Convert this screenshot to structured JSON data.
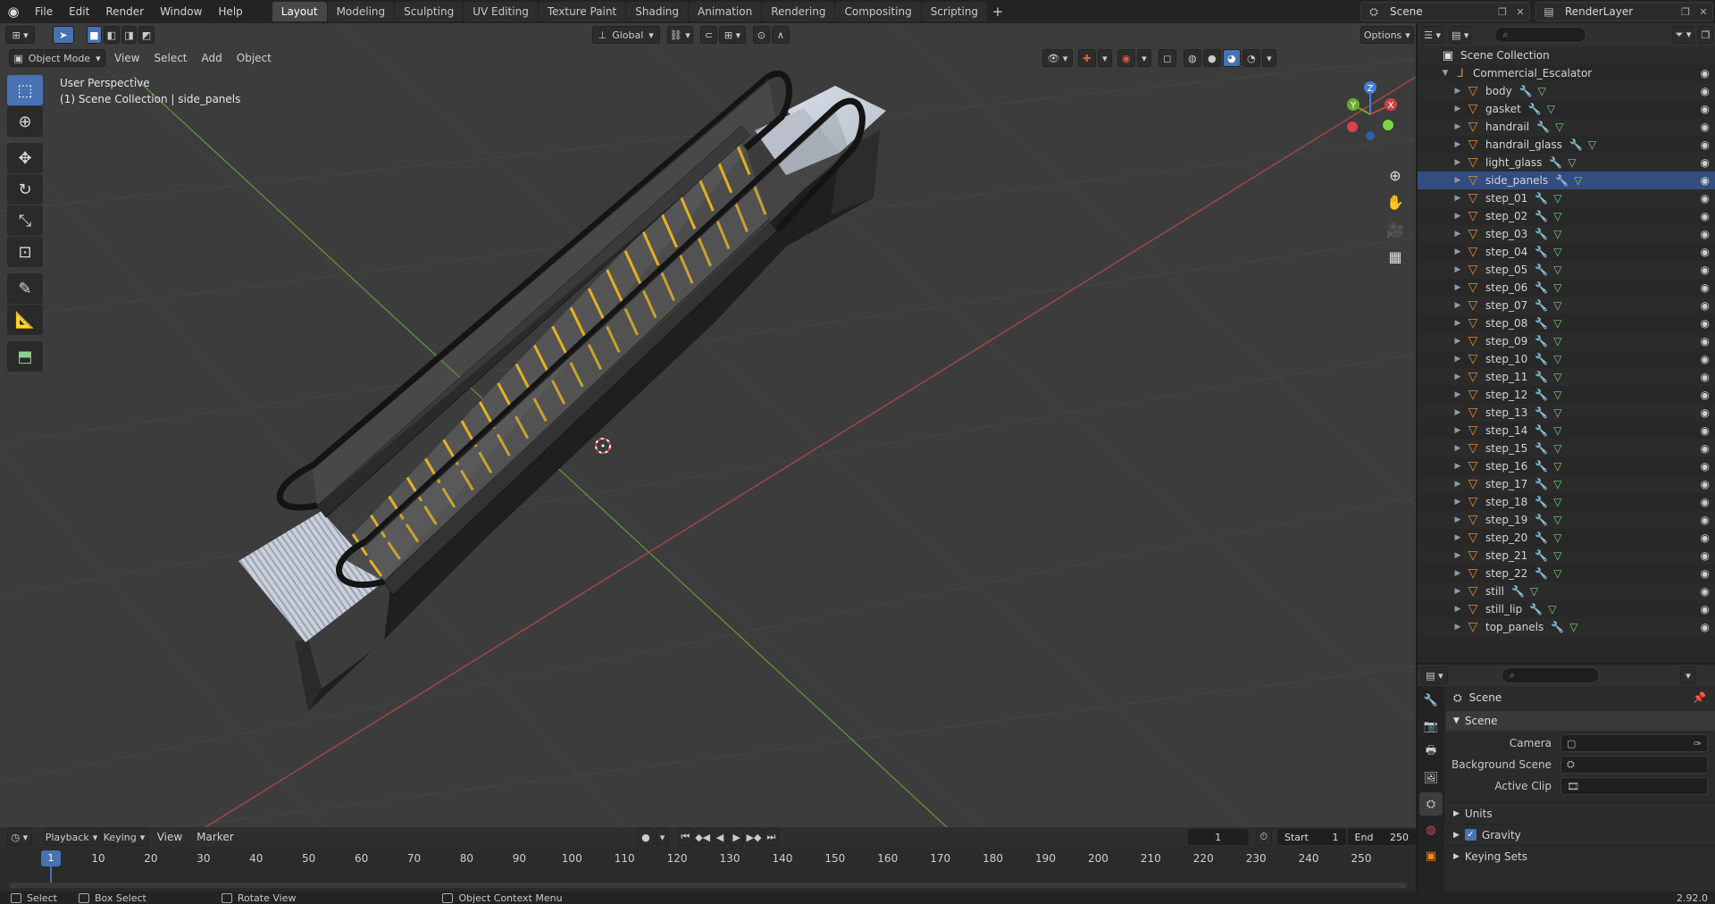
{
  "topbar": {
    "menus": [
      "File",
      "Edit",
      "Render",
      "Window",
      "Help"
    ],
    "workspaces": [
      "Layout",
      "Modeling",
      "Sculpting",
      "UV Editing",
      "Texture Paint",
      "Shading",
      "Animation",
      "Rendering",
      "Compositing",
      "Scripting"
    ],
    "active_workspace": "Layout",
    "add_symbol": "+",
    "scene_name": "Scene",
    "view_layer": "RenderLayer"
  },
  "viewport": {
    "mode": "Object Mode",
    "menus": [
      "View",
      "Select",
      "Add",
      "Object"
    ],
    "transform_orientation": "Global",
    "options_label": "Options",
    "perspective_label": "User Perspective",
    "context_label": "(1) Scene Collection | side_panels",
    "gizmo_axes": {
      "x": "X",
      "y": "Y",
      "z": "Z"
    },
    "colors": {
      "x_axis": "#c9434b",
      "y_axis": "#6bab2f",
      "z_axis": "#3f7fd8",
      "handrail": "#141414",
      "step_edge": "#e3b21f"
    }
  },
  "outliner": {
    "root": "Scene Collection",
    "collection": "Commercial_Escalator",
    "objects": [
      {
        "name": "body"
      },
      {
        "name": "gasket"
      },
      {
        "name": "handrail"
      },
      {
        "name": "handrail_glass"
      },
      {
        "name": "light_glass"
      },
      {
        "name": "side_panels",
        "selected": true
      },
      {
        "name": "step_01"
      },
      {
        "name": "step_02"
      },
      {
        "name": "step_03"
      },
      {
        "name": "step_04"
      },
      {
        "name": "step_05"
      },
      {
        "name": "step_06"
      },
      {
        "name": "step_07"
      },
      {
        "name": "step_08"
      },
      {
        "name": "step_09"
      },
      {
        "name": "step_10"
      },
      {
        "name": "step_11"
      },
      {
        "name": "step_12"
      },
      {
        "name": "step_13"
      },
      {
        "name": "step_14"
      },
      {
        "name": "step_15"
      },
      {
        "name": "step_16"
      },
      {
        "name": "step_17"
      },
      {
        "name": "step_18"
      },
      {
        "name": "step_19"
      },
      {
        "name": "step_20"
      },
      {
        "name": "step_21"
      },
      {
        "name": "step_22"
      },
      {
        "name": "still"
      },
      {
        "name": "still_lip"
      },
      {
        "name": "top_panels"
      }
    ]
  },
  "properties": {
    "context_title": "Scene",
    "panel_title": "Scene",
    "fields": [
      {
        "label": "Camera",
        "value": ""
      },
      {
        "label": "Background Scene",
        "value": ""
      },
      {
        "label": "Active Clip",
        "value": ""
      }
    ],
    "subpanels": [
      "Units",
      "Gravity",
      "Keying Sets"
    ],
    "gravity_checked": true
  },
  "timeline": {
    "menus": [
      "Playback",
      "Keying",
      "View",
      "Marker"
    ],
    "current_frame": "1",
    "start_label": "Start",
    "start": "1",
    "end_label": "End",
    "end": "250",
    "ticks": [
      "1",
      "10",
      "20",
      "30",
      "40",
      "50",
      "60",
      "70",
      "80",
      "90",
      "100",
      "110",
      "120",
      "130",
      "140",
      "150",
      "160",
      "170",
      "180",
      "190",
      "200",
      "210",
      "220",
      "230",
      "240",
      "250"
    ]
  },
  "statusbar": {
    "items": [
      "Select",
      "Box Select",
      "Rotate View",
      "Object Context Menu"
    ],
    "version": "2.92.0"
  }
}
